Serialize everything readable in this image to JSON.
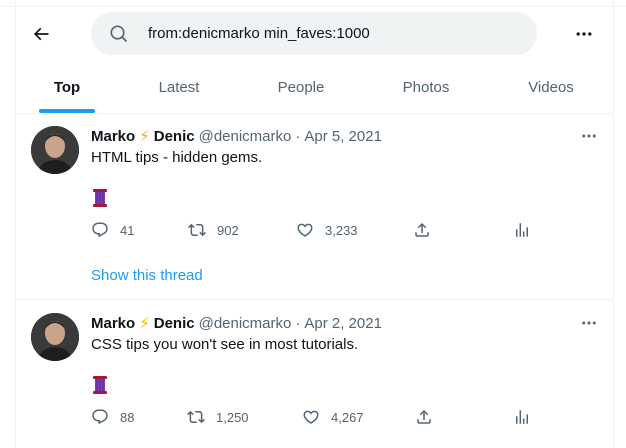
{
  "search": {
    "query": "from:denicmarko min_faves:1000"
  },
  "tabs": [
    {
      "label": "Top",
      "active": true
    },
    {
      "label": "Latest",
      "active": false
    },
    {
      "label": "People",
      "active": false
    },
    {
      "label": "Photos",
      "active": false
    },
    {
      "label": "Videos",
      "active": false
    }
  ],
  "tweets": [
    {
      "first_name": "Marko",
      "bolt": "⚡",
      "last_name": "Denic",
      "handle": "@denicmarko",
      "separator": "·",
      "date": "Apr 5, 2021",
      "text": "HTML tips - hidden gems.",
      "thread_emoji": "thread-spool-icon",
      "replies": "41",
      "retweets": "902",
      "likes": "3,233",
      "show_thread": "Show this thread"
    },
    {
      "first_name": "Marko",
      "bolt": "⚡",
      "last_name": "Denic",
      "handle": "@denicmarko",
      "separator": "·",
      "date": "Apr 2, 2021",
      "text": "CSS tips you won't see in most tutorials.",
      "thread_emoji": "thread-spool-icon",
      "replies": "88",
      "retweets": "1,250",
      "likes": "4,267"
    }
  ],
  "colors": {
    "accent": "#1d9bf0",
    "secondary_text": "#536471",
    "primary_text": "#0f1419",
    "search_bg": "#eff3f4",
    "bolt": "#f4b400"
  }
}
